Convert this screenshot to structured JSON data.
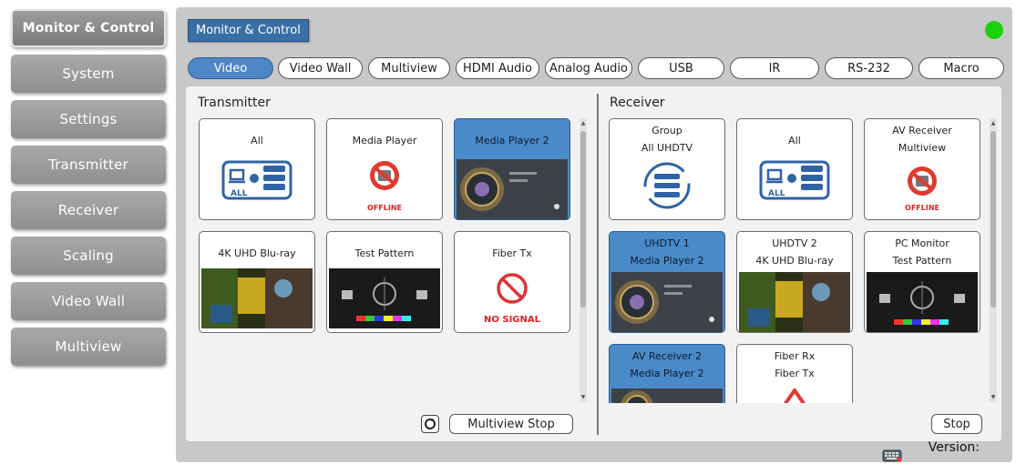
{
  "sidebar": {
    "items": [
      {
        "label": "Monitor & Control",
        "active": true
      },
      {
        "label": "System"
      },
      {
        "label": "Settings"
      },
      {
        "label": "Transmitter"
      },
      {
        "label": "Receiver"
      },
      {
        "label": "Scaling"
      },
      {
        "label": "Video Wall"
      },
      {
        "label": "Multiview"
      }
    ]
  },
  "header": {
    "title": "Monitor & Control",
    "status_color": "#1bd10c"
  },
  "tabs": [
    {
      "label": "Video",
      "active": true
    },
    {
      "label": "Video Wall"
    },
    {
      "label": "Multiview"
    },
    {
      "label": "HDMI Audio"
    },
    {
      "label": "Analog Audio"
    },
    {
      "label": "USB"
    },
    {
      "label": "IR"
    },
    {
      "label": "RS-232"
    },
    {
      "label": "Macro"
    }
  ],
  "transmitter": {
    "label": "Transmitter",
    "tiles": [
      {
        "line1": "All",
        "icon": "all-devices-icon"
      },
      {
        "line1": "Media Player",
        "icon": "offline-icon",
        "status": "OFFLINE"
      },
      {
        "line1": "Media Player 2",
        "icon": "video-thumbnail",
        "selected": true
      },
      {
        "line1": "4K UHD Blu-ray",
        "icon": "video-thumbnail"
      },
      {
        "line1": "Test Pattern",
        "icon": "test-pattern-thumbnail"
      },
      {
        "line1": "Fiber Tx",
        "icon": "no-signal-icon",
        "status": "NO SIGNAL"
      }
    ],
    "refresh_icon": "refresh-icon",
    "multiview_stop_label": "Multiview Stop"
  },
  "receiver": {
    "label": "Receiver",
    "tiles": [
      {
        "line1": "Group",
        "line2": "All UHDTV",
        "icon": "group-sync-icon"
      },
      {
        "line1": "All",
        "icon": "all-devices-icon"
      },
      {
        "line1": "AV Receiver",
        "line2": "Multiview",
        "icon": "offline-icon",
        "status": "OFFLINE"
      },
      {
        "line1": "UHDTV 1",
        "line2": "Media Player 2",
        "icon": "video-thumbnail",
        "selected": true
      },
      {
        "line1": "UHDTV 2",
        "line2": "4K UHD Blu-ray",
        "icon": "video-thumbnail"
      },
      {
        "line1": "PC Monitor",
        "line2": "Test Pattern",
        "icon": "test-pattern-thumbnail"
      },
      {
        "line1": "AV Receiver 2",
        "line2": "Media Player 2",
        "icon": "video-thumbnail",
        "selected": true
      },
      {
        "line1": "Fiber Rx",
        "line2": "Fiber Tx",
        "icon": "warning-icon"
      }
    ],
    "stop_label": "Stop"
  },
  "tile_labels": {
    "all_badge": "ALL"
  },
  "footer": {
    "version_label": "Version:",
    "keyboard_icon": "keyboard-icon"
  }
}
